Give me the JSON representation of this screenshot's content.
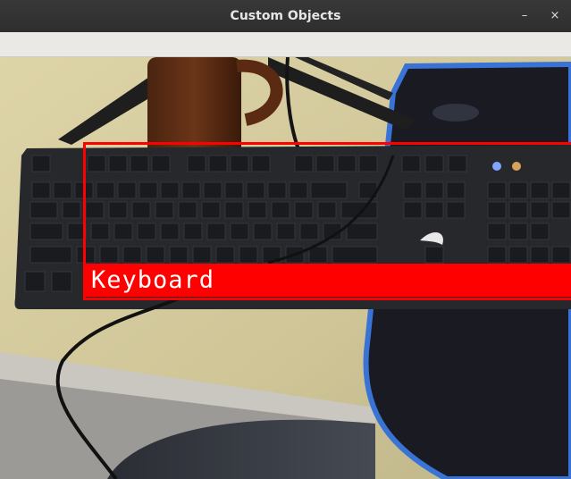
{
  "window": {
    "title": "Custom Objects",
    "minimize_symbol": "–",
    "close_symbol": "×"
  },
  "detection": {
    "label": "Keyboard",
    "box_color": "#ff0000",
    "label_text_color": "#ffffff"
  }
}
